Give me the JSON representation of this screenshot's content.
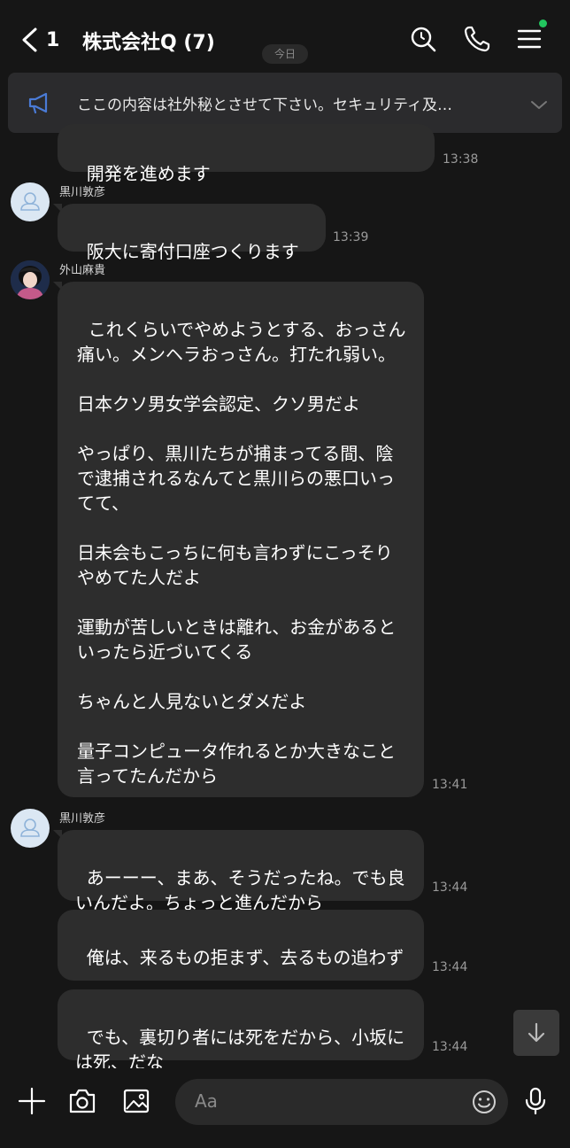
{
  "header": {
    "back_count": "1",
    "title": "株式会社Q (7)",
    "icons": [
      "search-icon",
      "phone-icon",
      "menu-icon"
    ],
    "notification_color": "#22c55e"
  },
  "date_badge": "今日",
  "announcement": {
    "icon": "megaphone-icon",
    "text": "ここの内容は社外秘とさせて下さい。セキュリティ及…"
  },
  "messages": [
    {
      "text": "開発を進めます",
      "time": "13:38"
    },
    {
      "sender": "黒川敦彦",
      "avatar": "default-user-icon",
      "text": "阪大に寄付口座つくります",
      "time": "13:39"
    },
    {
      "sender": "外山麻貴",
      "avatar": "profile-photo",
      "text": "これくらいでやめようとする、おっさん痛い。メンヘラおっさん。打たれ弱い。\n\n日本クソ男女学会認定、クソ男だよ\n\nやっぱり、黒川たちが捕まってる間、陰で逮捕されるなんてと黒川らの悪口いってて、\n\n日未会もこっちに何も言わずにこっそりやめてた人だよ\n\n運動が苦しいときは離れ、お金があるといったら近づいてくる\n\nちゃんと人見ないとダメだよ\n\n量子コンピュータ作れるとか大きなこと言ってたんだから",
      "time": "13:41"
    },
    {
      "sender": "黒川敦彦",
      "avatar": "default-user-icon",
      "text": "あーーー、まあ、そうだったね。でも良いんだよ。ちょっと進んだから",
      "time": "13:44"
    },
    {
      "text": "俺は、来るもの拒まず、去るもの追わず",
      "time": "13:44"
    },
    {
      "text": "でも、裏切り者には死をだから、小坂には死、だな",
      "time": "13:44"
    }
  ],
  "composer": {
    "placeholder": "Aa",
    "icons": [
      "plus-icon",
      "camera-icon",
      "image-icon",
      "emoji-icon",
      "microphone-icon"
    ]
  },
  "scroll_down_icon": "arrow-down-icon"
}
